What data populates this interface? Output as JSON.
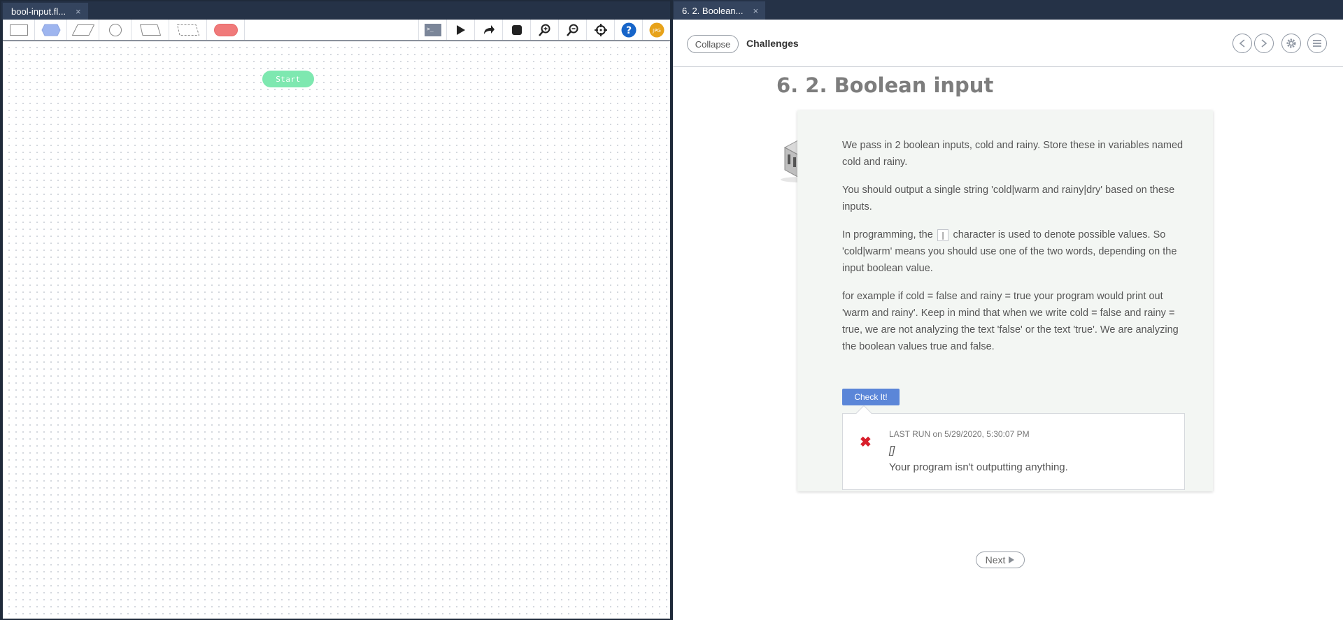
{
  "left_window": {
    "tab": {
      "label": "bool-input.fl...",
      "close": "×"
    },
    "shape_tools": [
      "process",
      "decision",
      "input-output",
      "connector",
      "manual-input",
      "predefined",
      "terminal"
    ],
    "tool_buttons": [
      "terminal-icon",
      "play-icon",
      "step-icon",
      "stop-icon",
      "zoom-in-icon",
      "zoom-out-icon",
      "center-icon",
      "help-icon",
      "user-icon"
    ],
    "help_label": "?",
    "user_initials": "JPG",
    "canvas": {
      "start_label": "Start"
    },
    "colors": {
      "decision": "#9eb5ef",
      "terminal": "#f07a7a",
      "start": "#7ee8b0",
      "help": "#1765c9",
      "user": "#e7a21a"
    }
  },
  "right_window": {
    "tab": {
      "label": "6. 2. Boolean...",
      "close": "×"
    },
    "header": {
      "collapse_label": "Collapse",
      "title": "Challenges"
    },
    "nav_icons": [
      "prev-icon",
      "next-icon",
      "settings-icon",
      "menu-icon"
    ],
    "page_title": "6. 2. Boolean input",
    "paragraphs": {
      "p1": "We pass in 2 boolean inputs, cold and rainy. Store these in variables named cold and rainy.",
      "p2": "You should output a single string 'cold|warm and rainy|dry' based on these inputs.",
      "p3_before": "In programming, the",
      "p3_code": "|",
      "p3_after": "character is used to denote possible values. So 'cold|warm' means you should use one of the two words, depending on the input boolean value.",
      "p4": "for example if cold = false and rainy = true your program would print out 'warm and rainy'. Keep in mind that when we write cold = false and rainy = true, we are not analyzing the text 'false' or the text 'true'. We are analyzing the boolean values true and false."
    },
    "check_label": "Check It!",
    "result": {
      "status_icon": "error-x-icon",
      "last_run_label": "Last Run",
      "last_run_time": "on 5/29/2020, 5:30:07 PM",
      "output": "[]",
      "message": "Your program isn't outputting anything."
    },
    "next_label": "Next",
    "colors": {
      "check_button": "#5b86d8",
      "error": "#d81e2b"
    }
  }
}
